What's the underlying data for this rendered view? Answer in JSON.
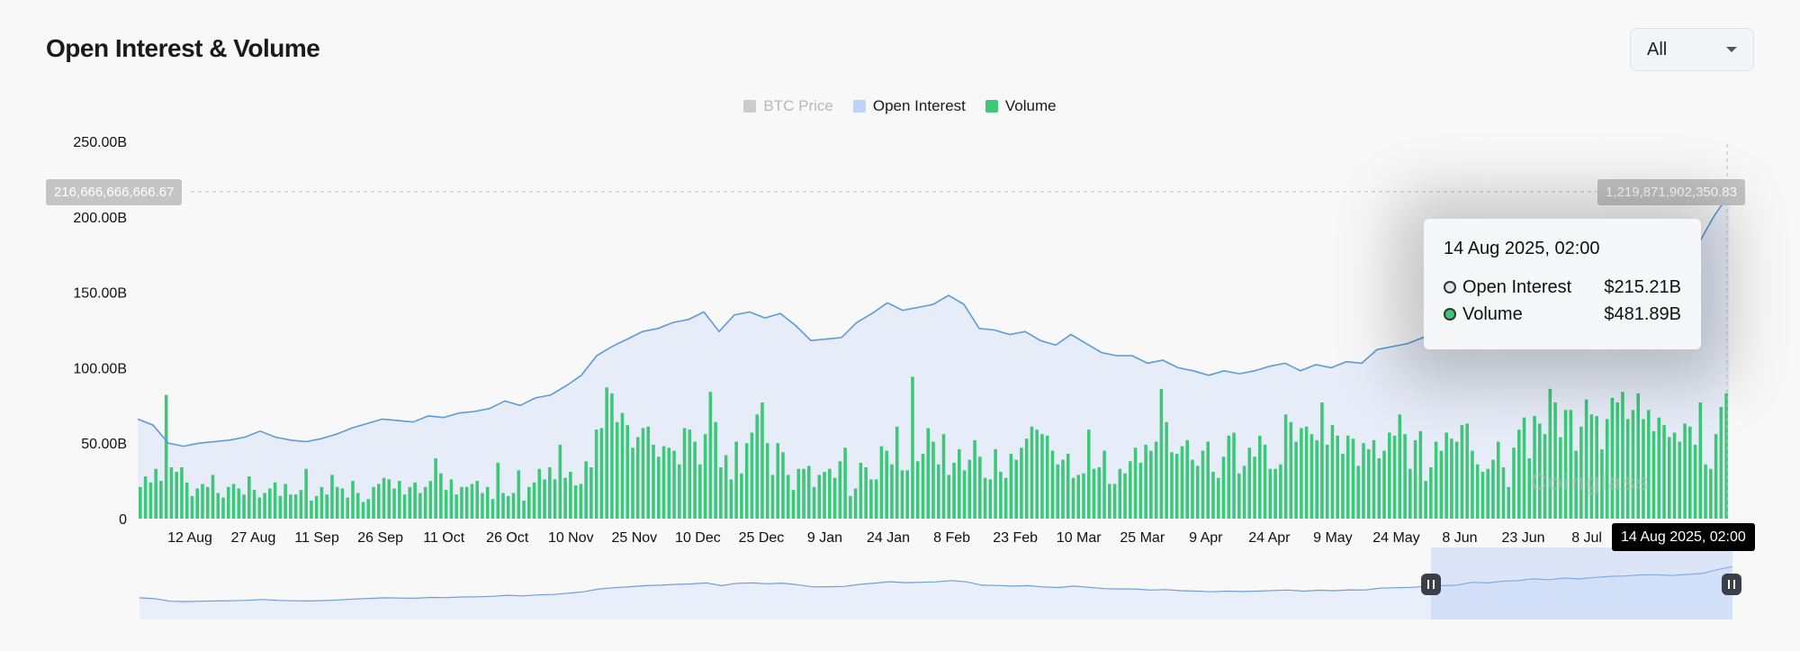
{
  "title": "Open Interest & Volume",
  "range_select": {
    "value": "All"
  },
  "legend": [
    {
      "name": "BTC Price",
      "color": "#cccccc",
      "active": false
    },
    {
      "name": "Open Interest",
      "color": "#bcd2f7",
      "active": true
    },
    {
      "name": "Volume",
      "color": "#3cc878",
      "active": true
    }
  ],
  "hover": {
    "left_axis_value": "216,666,666,666.67",
    "right_axis_value": "1,219,871,902,350.83",
    "date_flag": "14 Aug 2025, 02:00"
  },
  "tooltip": {
    "title": "14 Aug 2025, 02:00",
    "rows": [
      {
        "name": "Open Interest",
        "value": "$215.21B",
        "dot_color": "#dfe6ef"
      },
      {
        "name": "Volume",
        "value": "$481.89B",
        "dot_color": "#3cc878"
      }
    ]
  },
  "watermark": "Coinglass",
  "chart_data": {
    "type": "bar",
    "ylim": [
      0,
      250
    ],
    "y_ticks": [
      "250.00B",
      "200.00B",
      "150.00B",
      "100.00B",
      "50.00B",
      "0"
    ],
    "y_tick_values": [
      250,
      200,
      150,
      100,
      50,
      0
    ],
    "x_ticks": [
      "12 Aug",
      "27 Aug",
      "11 Sep",
      "26 Sep",
      "11 Oct",
      "26 Oct",
      "10 Nov",
      "25 Nov",
      "10 Dec",
      "25 Dec",
      "9 Jan",
      "24 Jan",
      "8 Feb",
      "23 Feb",
      "10 Mar",
      "25 Mar",
      "9 Apr",
      "24 Apr",
      "9 May",
      "24 May",
      "8 Jun",
      "23 Jun",
      "8 Jul"
    ],
    "series": [
      {
        "name": "Open Interest",
        "type": "line",
        "color": "#5b9bd9",
        "values": [
          66,
          62,
          50,
          48,
          50,
          51,
          52,
          54,
          58,
          54,
          52,
          51,
          53,
          56,
          60,
          63,
          66,
          65,
          64,
          68,
          67,
          70,
          71,
          73,
          78,
          75,
          80,
          82,
          88,
          95,
          108,
          114,
          119,
          124,
          126,
          130,
          132,
          137,
          124,
          135,
          137,
          133,
          136,
          128,
          118,
          119,
          120,
          130,
          136,
          143,
          138,
          140,
          142,
          148,
          142,
          126,
          125,
          122,
          124,
          118,
          115,
          122,
          116,
          110,
          108,
          108,
          103,
          105,
          100,
          98,
          95,
          98,
          96,
          98,
          101,
          103,
          98,
          102,
          100,
          104,
          103,
          112,
          114,
          116,
          120,
          124,
          126,
          140,
          137,
          145,
          148,
          156,
          152,
          160,
          156,
          163,
          168,
          170,
          175,
          176,
          172,
          177,
          182,
          200,
          215
        ]
      },
      {
        "name": "Volume",
        "type": "bar",
        "color": "#3cc878",
        "values": [
          21,
          28,
          24,
          33,
          25,
          82,
          34,
          31,
          34,
          24,
          15,
          20,
          23,
          21,
          29,
          17,
          14,
          21,
          23,
          20,
          16,
          28,
          19,
          14,
          17,
          20,
          24,
          15,
          23,
          16,
          16,
          19,
          33,
          12,
          15,
          21,
          16,
          29,
          21,
          20,
          14,
          25,
          17,
          11,
          13,
          21,
          23,
          27,
          26,
          20,
          25,
          16,
          21,
          24,
          17,
          21,
          25,
          40,
          30,
          19,
          26,
          16,
          21,
          21,
          23,
          25,
          17,
          21,
          13,
          37,
          17,
          15,
          17,
          32,
          12,
          21,
          24,
          33,
          26,
          34,
          26,
          49,
          27,
          31,
          22,
          23,
          38,
          34,
          59,
          60,
          87,
          83,
          64,
          70,
          62,
          47,
          54,
          60,
          61,
          49,
          41,
          48,
          47,
          45,
          36,
          60,
          59,
          51,
          36,
          56,
          84,
          64,
          34,
          42,
          26,
          51,
          30,
          50,
          57,
          69,
          77,
          50,
          29,
          50,
          44,
          29,
          19,
          33,
          33,
          35,
          21,
          29,
          31,
          33,
          27,
          38,
          47,
          15,
          20,
          37,
          34,
          26,
          26,
          48,
          45,
          36,
          61,
          32,
          32,
          94,
          38,
          43,
          60,
          51,
          36,
          56,
          29,
          37,
          46,
          32,
          39,
          52,
          41,
          27,
          26,
          46,
          31,
          27,
          43,
          39,
          47,
          53,
          61,
          59,
          56,
          55,
          45,
          36,
          39,
          43,
          27,
          29,
          30,
          59,
          33,
          34,
          45,
          23,
          23,
          33,
          30,
          38,
          47,
          37,
          49,
          45,
          51,
          86,
          64,
          44,
          43,
          48,
          52,
          39,
          35,
          45,
          51,
          31,
          27,
          41,
          55,
          57,
          30,
          35,
          47,
          41,
          55,
          49,
          33,
          33,
          36,
          69,
          64,
          51,
          60,
          61,
          56,
          52,
          77,
          49,
          62,
          55,
          43,
          55,
          53,
          35,
          50,
          46,
          52,
          40,
          45,
          57,
          55,
          69,
          56,
          33,
          52,
          58,
          25,
          34,
          51,
          45,
          57,
          53,
          51,
          62,
          63,
          45,
          36,
          31,
          33,
          39,
          51,
          34,
          21,
          47,
          59,
          67,
          40,
          68,
          63,
          56,
          86,
          77,
          54,
          72,
          72,
          45,
          61,
          79,
          69,
          68,
          46,
          66,
          80,
          77,
          84,
          66,
          72,
          83,
          66,
          72,
          58,
          67,
          62,
          54,
          57,
          51,
          63,
          61,
          49,
          77,
          36,
          33,
          56,
          74,
          83
        ]
      }
    ]
  }
}
